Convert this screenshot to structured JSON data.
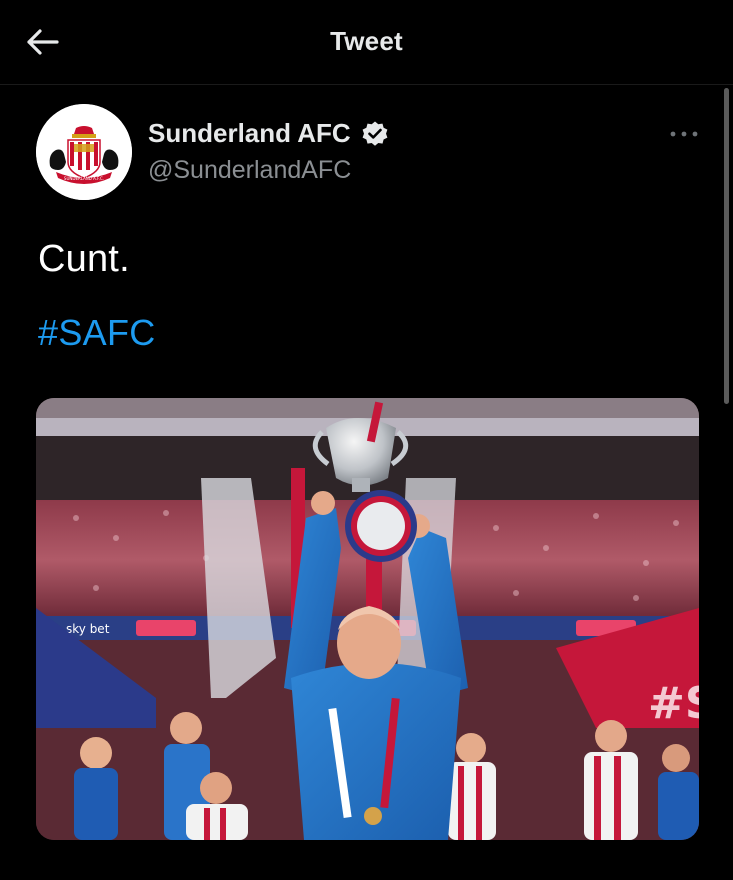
{
  "header": {
    "title": "Tweet",
    "back_icon": "arrow-left-icon"
  },
  "author": {
    "display_name": "Sunderland AFC",
    "handle": "@SunderlandAFC",
    "verified": true,
    "avatar_icon": "sunderland-crest",
    "avatar_crest_text": "SUNDERLAND A.F.C."
  },
  "more_icon": "more-horizontal-icon",
  "tweet": {
    "text": "Cunt.",
    "hashtag": "#SAFC"
  },
  "media": {
    "description_icon": "photo",
    "board_text_left": "sky bet",
    "board_text_right": "#S"
  },
  "colors": {
    "background": "#000000",
    "text": "#e7e9ea",
    "secondary_text": "#8b8f93",
    "link": "#1d9bf0"
  }
}
